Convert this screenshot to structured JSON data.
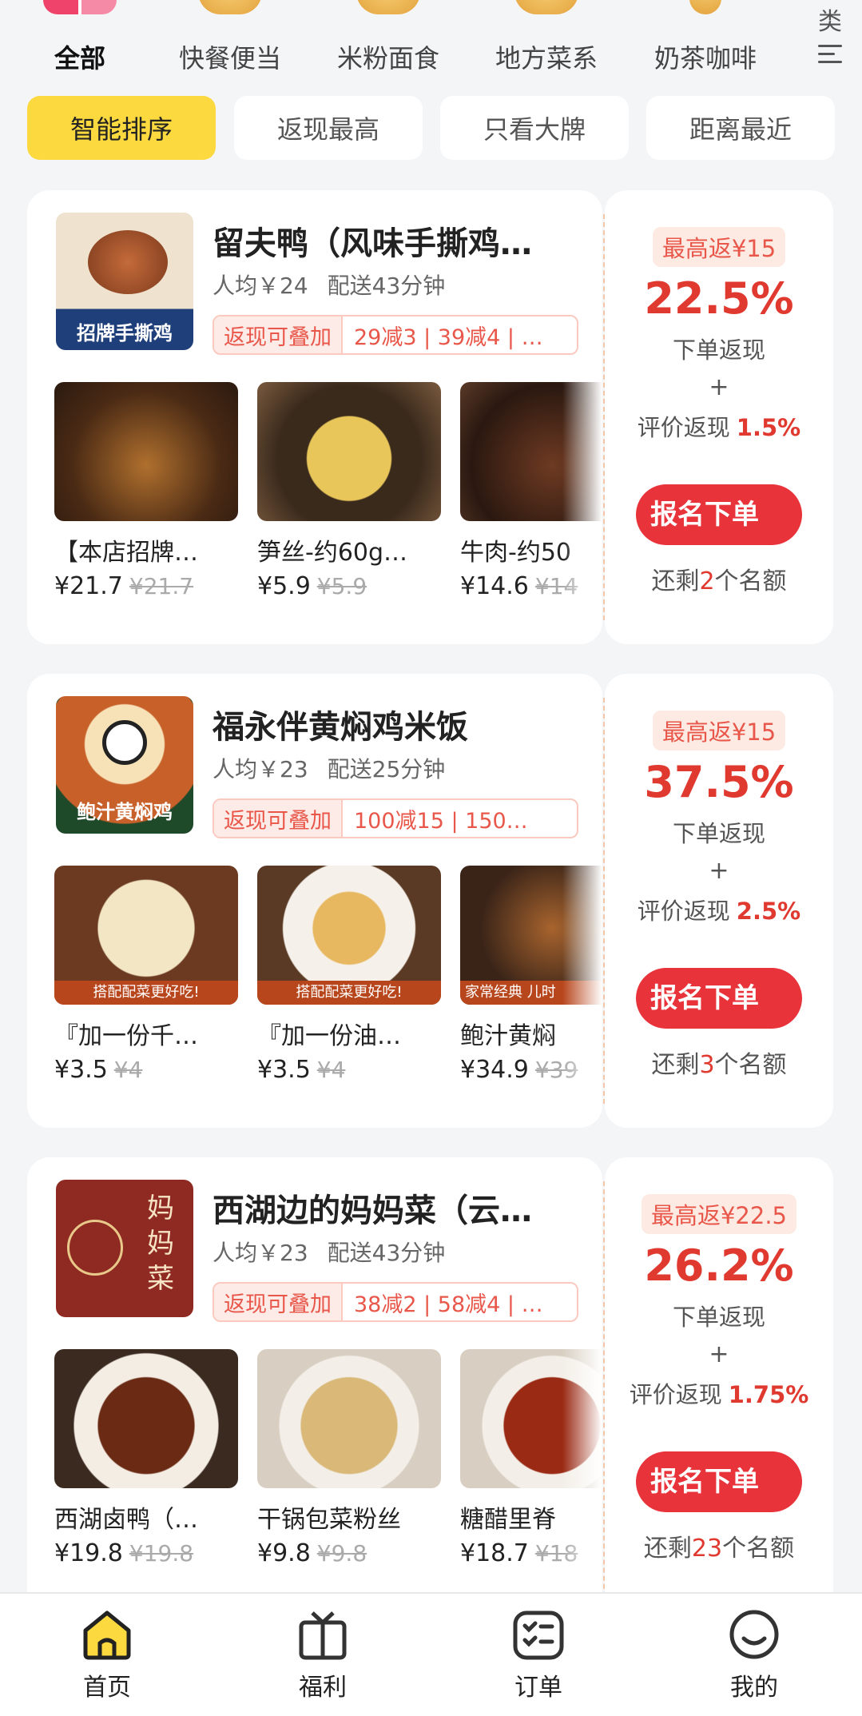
{
  "categories": {
    "items": [
      "全部",
      "快餐便当",
      "米粉面食",
      "地方菜系",
      "奶茶咖啡"
    ],
    "more_label": "类"
  },
  "sort": {
    "chips": [
      "智能排序",
      "返现最高",
      "只看大牌",
      "距离最近"
    ],
    "active": 0
  },
  "stores": [
    {
      "name": "留夫鸭（风味手撕鸡…",
      "avg": "人均￥24",
      "delivery": "配送43分钟",
      "stack_tag": "返现可叠加",
      "deals": "29减3 | 39减4 | …",
      "logo_text": "招牌手撕鸡",
      "dishes": [
        {
          "name": "【本店招牌…",
          "price": "¥21.7",
          "old": "¥21.7"
        },
        {
          "name": "笋丝-约60g…",
          "price": "¥5.9",
          "old": "¥5.9"
        },
        {
          "name": "牛肉-约50",
          "price": "¥14.6",
          "old": "¥14"
        }
      ],
      "max_back": "最高返¥15",
      "percent": "22.5%",
      "order_label": "下单返现",
      "plus": "+",
      "review_label": "评价返现",
      "review_pct": "1.5%",
      "button": "报名下单",
      "remain_pre": "还剩",
      "remain_num": "2",
      "remain_post": "个名额"
    },
    {
      "name": "福永伴黄焖鸡米饭",
      "avg": "人均￥23",
      "delivery": "配送25分钟",
      "stack_tag": "返现可叠加",
      "deals": "100减15 | 150…",
      "logo_text": "鲍汁黄焖鸡",
      "dishes": [
        {
          "name": "『加一份千…",
          "price": "¥3.5",
          "old": "¥4",
          "banner": "搭配配菜更好吃!"
        },
        {
          "name": "『加一份油…",
          "price": "¥3.5",
          "old": "¥4",
          "banner": "搭配配菜更好吃!"
        },
        {
          "name": "鲍汁黄焖",
          "price": "¥34.9",
          "old": "¥39",
          "banner": "家常经典 儿时"
        }
      ],
      "max_back": "最高返¥15",
      "percent": "37.5%",
      "order_label": "下单返现",
      "plus": "+",
      "review_label": "评价返现",
      "review_pct": "2.5%",
      "button": "报名下单",
      "remain_pre": "还剩",
      "remain_num": "3",
      "remain_post": "个名额"
    },
    {
      "name": "西湖边的妈妈菜（云…",
      "avg": "人均￥23",
      "delivery": "配送43分钟",
      "stack_tag": "返现可叠加",
      "deals": "38减2 | 58减4 | …",
      "logo_text": "妈妈菜",
      "dishes": [
        {
          "name": "西湖卤鸭（…",
          "price": "¥19.8",
          "old": "¥19.8"
        },
        {
          "name": "干锅包菜粉丝",
          "price": "¥9.8",
          "old": "¥9.8"
        },
        {
          "name": "糖醋里脊",
          "price": "¥18.7",
          "old": "¥18"
        }
      ],
      "max_back": "最高返¥22.5",
      "percent": "26.2%",
      "order_label": "下单返现",
      "plus": "+",
      "review_label": "评价返现",
      "review_pct": "1.75%",
      "button": "报名下单",
      "remain_pre": "还剩",
      "remain_num": "23",
      "remain_post": "个名额"
    }
  ],
  "tabbar": [
    "首页",
    "福利",
    "订单",
    "我的"
  ],
  "colors": {
    "accent_yellow": "#fcd93f",
    "cashback_red": "#e03a30",
    "button_red": "#e8333a"
  }
}
